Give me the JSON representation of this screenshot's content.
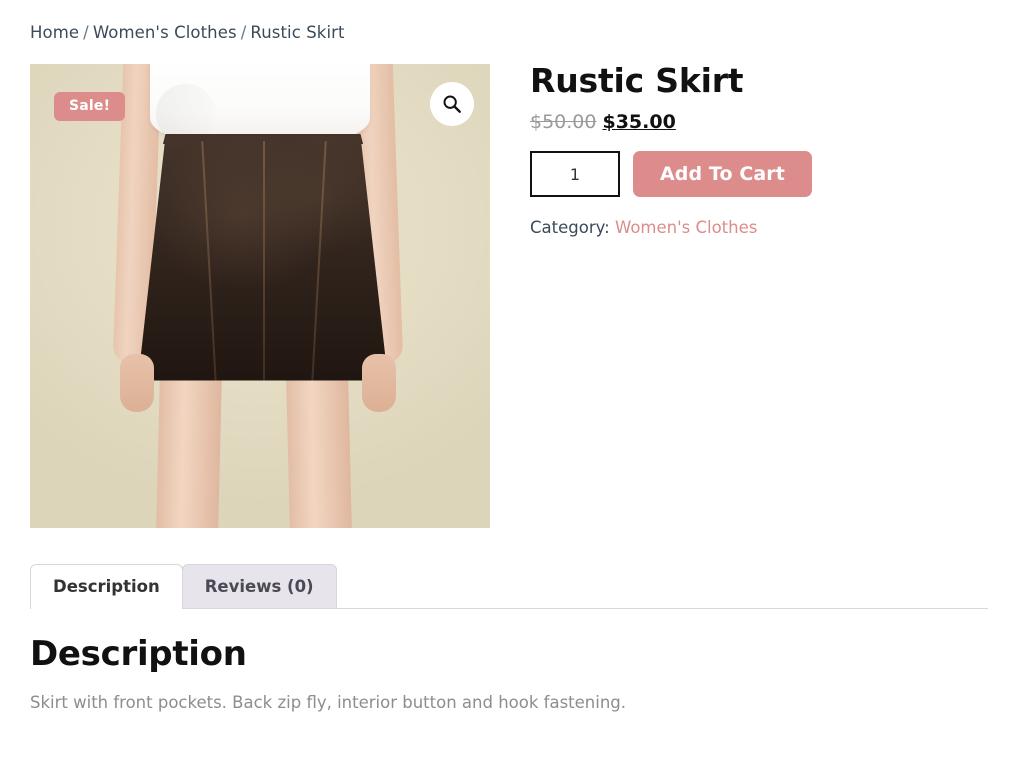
{
  "breadcrumb": {
    "items": [
      "Home",
      "Women's Clothes",
      "Rustic Skirt"
    ],
    "separator": "/"
  },
  "gallery": {
    "sale_badge": "Sale!",
    "zoom_icon": "magnifier-icon",
    "image_alt": "Rustic Skirt - model wearing dark brown suede A-line skirt with white top",
    "background_color": "#e4ddc4",
    "skirt_color": "#32231a"
  },
  "product": {
    "title": "Rustic Skirt",
    "price_old": "$50.00",
    "price_new": "$35.00",
    "quantity_value": "1",
    "quantity_placeholder": "1",
    "add_to_cart_label": "Add To Cart",
    "category_label": "Category:",
    "category_value": "Women's Clothes"
  },
  "tabs": [
    {
      "label": "Description",
      "active": true
    },
    {
      "label": "Reviews (0)",
      "active": false
    }
  ],
  "description": {
    "heading": "Description",
    "text": "Skirt with front pockets. Back zip fly, interior button and hook fastening."
  },
  "colors": {
    "accent": "#dd8c8c",
    "text_dark": "#111111",
    "text_muted": "#8d8d8d",
    "breadcrumb": "#3b4a5a",
    "tab_inactive_bg": "#e7e4ec",
    "tab_border": "#d8d4e0"
  }
}
